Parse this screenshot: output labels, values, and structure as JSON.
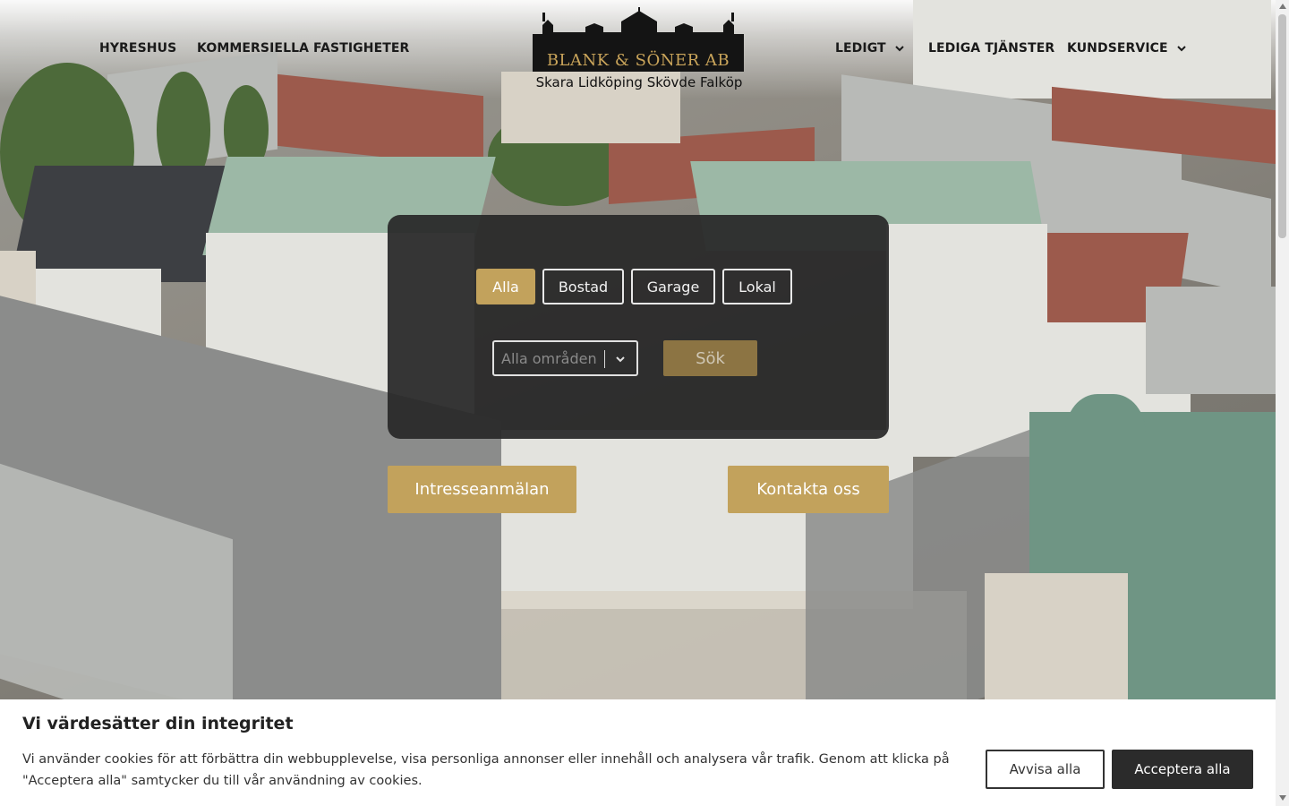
{
  "nav": {
    "left": [
      {
        "label": "HYRESHUS"
      },
      {
        "label": "KOMMERSIELLA FASTIGHETER"
      }
    ],
    "right": [
      {
        "label": "LEDIGT",
        "has_dropdown": true
      },
      {
        "label": "LEDIGA TJÄNSTER",
        "has_dropdown": false
      },
      {
        "label": "KUNDSERVICE",
        "has_dropdown": true
      }
    ]
  },
  "logo": {
    "name": "BLANK & SÖNER AB",
    "tagline": "Skara Lidköping Skövde Falköp"
  },
  "search": {
    "filters": [
      {
        "label": "Alla",
        "active": true
      },
      {
        "label": "Bostad",
        "active": false
      },
      {
        "label": "Garage",
        "active": false
      },
      {
        "label": "Lokal",
        "active": false
      }
    ],
    "area_placeholder": "Alla områden",
    "search_label": "Sök"
  },
  "cta": {
    "interest_label": "Intresseanmälan",
    "contact_label": "Kontakta oss"
  },
  "cookie": {
    "title": "Vi värdesätter din integritet",
    "text": "Vi använder cookies för att förbättra din webbupplevelse, visa personliga annonser eller innehåll och analysera vår trafik. Genom att klicka på \"Acceptera alla\" samtycker du till vår användning av cookies.",
    "reject_label": "Avvisa alla",
    "accept_label": "Acceptera alla"
  },
  "colors": {
    "accent_gold": "#c2a25c",
    "panel_bg": "#282828",
    "logo_gold": "#c9a45a"
  }
}
